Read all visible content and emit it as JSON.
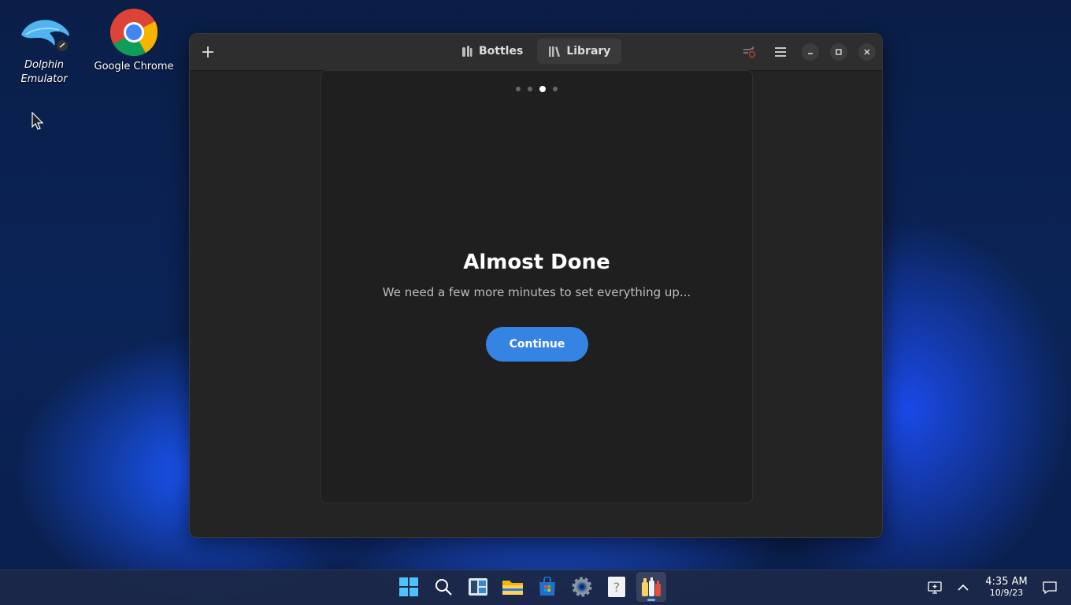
{
  "desktop": {
    "icons": [
      {
        "label": "Dolphin Emulator",
        "line1": "Dolphin",
        "line2": "Emulator"
      },
      {
        "label": "Google Chrome"
      }
    ]
  },
  "window": {
    "tabs": [
      {
        "label": "Bottles",
        "active": false
      },
      {
        "label": "Library",
        "active": true
      }
    ],
    "onboarding": {
      "pages": 4,
      "current_page": 3,
      "title": "Almost Done",
      "subtitle": "We need a few more minutes to set everything up...",
      "continue_label": "Continue"
    }
  },
  "taskbar": {
    "time": "4:35 AM",
    "date": "10/9/23"
  },
  "colors": {
    "accent": "#3584e4",
    "window_bg": "#242424",
    "headerbar_bg": "#2e2e2e"
  }
}
